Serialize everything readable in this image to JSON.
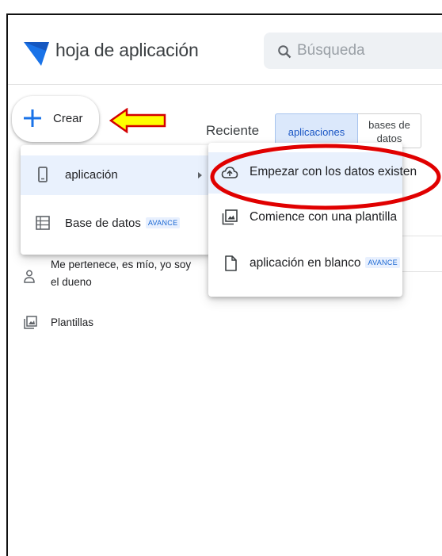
{
  "header": {
    "app_title": "hoja de aplicación",
    "search_placeholder": "Búsqueda"
  },
  "create_button": {
    "label": "Crear"
  },
  "recent": {
    "label": "Reciente",
    "tabs": [
      {
        "label": "aplicaciones",
        "selected": true
      },
      {
        "label": "bases de datos",
        "selected": false
      }
    ]
  },
  "create_menu": {
    "items": [
      {
        "label": "aplicación",
        "icon": "phone-icon",
        "highlighted": true,
        "has_submenu": true
      },
      {
        "label": "Base de datos",
        "icon": "table-icon",
        "badge": "AVANCE"
      }
    ]
  },
  "app_submenu": {
    "items": [
      {
        "label": "Empezar con los datos existen",
        "icon": "cloud-upload-icon",
        "highlighted": true
      },
      {
        "label": "Comience con una plantilla",
        "icon": "template-icon"
      },
      {
        "label": "aplicación en blanco",
        "icon": "blank-file-icon",
        "badge": "AVANCE"
      }
    ]
  },
  "sidebar": {
    "items": [
      {
        "label": "Me pertenece, es mío, yo soy el dueno",
        "icon": "person-icon"
      },
      {
        "label": "Plantillas",
        "icon": "template-icon"
      }
    ]
  },
  "colors": {
    "brand_blue": "#1a73e8",
    "annotation_arrow": "#ffff00",
    "annotation_arrow_stroke": "#d40000",
    "annotation_ellipse": "#e00000",
    "highlight_bg": "#e9f1fd"
  }
}
